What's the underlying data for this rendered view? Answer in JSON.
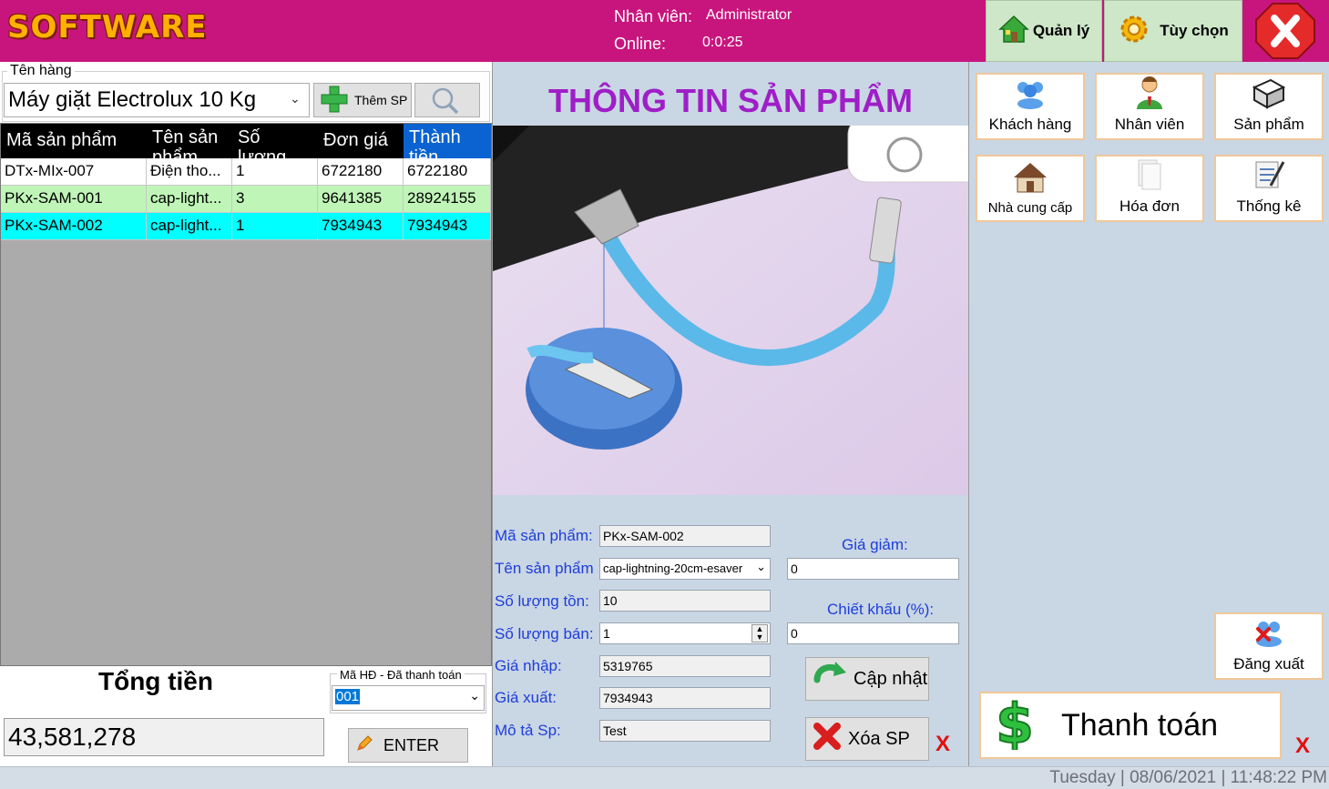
{
  "header": {
    "logo": "SOFTWARE",
    "employee_label": "Nhân viên:",
    "employee_name": "Administrator",
    "online_label": "Online:",
    "online_time": "0:0:25",
    "manage_label": "Quản lý",
    "options_label": "Tùy chọn",
    "brand_color": "#c8157d"
  },
  "product_picker": {
    "group_title": "Tên hàng",
    "selected": "Máy giặt Electrolux 10 Kg",
    "add_label": "Thêm SP"
  },
  "cart": {
    "columns": [
      "Mã sản phẩm",
      "Tên sản phẩm",
      "Số lượng",
      "Đơn giá",
      "Thành tiền"
    ],
    "rows": [
      [
        "DTx-MIx-007",
        "Điện tho...",
        "1",
        "6722180",
        "6722180"
      ],
      [
        "PKx-SAM-001",
        "cap-light...",
        "3",
        "9641385",
        "28924155"
      ],
      [
        "PKx-SAM-002",
        "cap-light...",
        "1",
        "7934943",
        "7934943"
      ]
    ],
    "row_colors": [
      "#ffffff",
      "#c0f5b8",
      "#00ffff"
    ]
  },
  "totals": {
    "label": "Tổng tiền",
    "value": "43,581,278",
    "invoice_title": "Mã HĐ - Đã thanh toán",
    "invoice_value": "001",
    "enter_label": "ENTER"
  },
  "product_info": {
    "title": "THÔNG TIN SẢN PHẨM",
    "fields": {
      "code_label": "Mã sản phẩm:",
      "code_value": "PKx-SAM-002",
      "name_label": "Tên sản phẩm",
      "name_value": "cap-lightning-20cm-esaver",
      "stock_label": "Số lượng tồn:",
      "stock_value": "10",
      "sell_label": "Số lượng bán:",
      "sell_value": "1",
      "import_label": "Giá nhập:",
      "import_value": "5319765",
      "export_label": "Giá xuất:",
      "export_value": "7934943",
      "desc_label": "Mô tả Sp:",
      "desc_value": "Test",
      "discount_label": "Giá giảm:",
      "discount_value": "0",
      "rebate_label": "Chiết khấu (%):",
      "rebate_value": "0"
    },
    "update_label": "Cập nhật",
    "delete_label": "Xóa SP",
    "title_color": "#9f1ec7"
  },
  "menu": {
    "customers": "Khách hàng",
    "employees": "Nhân viên",
    "products": "Sản phẩm",
    "suppliers": "Nhà cung cấp",
    "invoices": "Hóa đơn",
    "statistics": "Thống kê",
    "logout": "Đăng xuất",
    "pay": "Thanh toán"
  },
  "status_bar": {
    "text": "Tuesday  |  08/06/2021   |  11:48:22 PM"
  }
}
